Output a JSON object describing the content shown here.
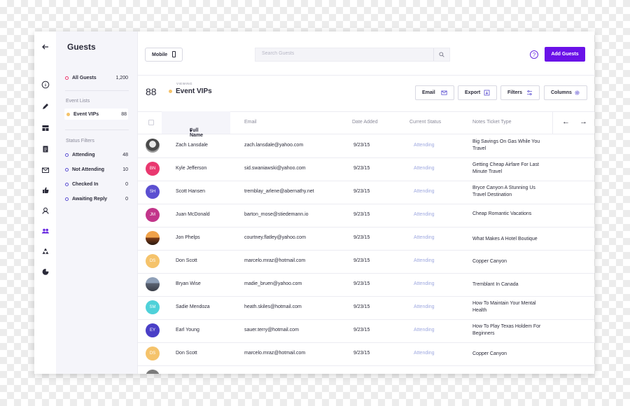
{
  "rail": {
    "icons": [
      "back-arrow-icon",
      "info-icon",
      "pen-icon",
      "dashboard-icon",
      "clipboard-icon",
      "mail-icon",
      "thumbs-up-icon",
      "person-icon",
      "group-icon",
      "recycle-icon",
      "pie-chart-icon"
    ]
  },
  "sidebar": {
    "title": "Guests",
    "all_guests": {
      "label": "All Guests",
      "count": "1,200"
    },
    "event_lists_heading": "Event Lists",
    "event_vips": {
      "label": "Event VIPs",
      "count": "88"
    },
    "status_filters_heading": "Status Filters",
    "filters": [
      {
        "label": "Attending",
        "count": "48"
      },
      {
        "label": "Not Attending",
        "count": "10"
      },
      {
        "label": "Checked In",
        "count": "0"
      },
      {
        "label": "Awaiting Reply",
        "count": "0"
      }
    ]
  },
  "topbar": {
    "mobile_label": "Mobile",
    "search_placeholder": "Search Guests",
    "add_label": "Add Guests",
    "help_glyph": "?"
  },
  "header": {
    "count": "88",
    "viewing_label": "VIEWING",
    "title": "Event VIPs",
    "buttons": [
      "Email",
      "Export",
      "Filters",
      "Columns"
    ]
  },
  "table": {
    "columns": [
      "Full Name",
      "Email",
      "Date Added",
      "Current Status",
      "Notes Ticket Type"
    ],
    "rows": [
      {
        "initials": "",
        "color": "#7c8b86",
        "name": "Zach Lansdale",
        "email": "zach.lansdale@yahoo.com",
        "date": "9/23/15",
        "status": "Attending",
        "note": "Big Savings On Gas While You Travel"
      },
      {
        "initials": "BN",
        "color": "#e9386f",
        "name": "Kyle Jefferson",
        "email": "sid.swaniawski@yahoo.com",
        "date": "9/23/15",
        "status": "Attending",
        "note": "Getting Cheap Airfare For Last Minute Travel"
      },
      {
        "initials": "SH",
        "color": "#5b4fd1",
        "name": "Scott Hansen",
        "email": "tremblay_arlene@abernathy.net",
        "date": "9/23/15",
        "status": "Attending",
        "note": "Bryce Canyon A Stunning Us Travel Destination"
      },
      {
        "initials": "JM",
        "color": "#c2358a",
        "name": "Juan McDonald",
        "email": "barton_mose@stiedemann.io",
        "date": "9/23/15",
        "status": "Attending",
        "note": "Cheap Romantic Vacations"
      },
      {
        "initials": "",
        "color": "#b86a2a",
        "name": "Jon Phelps",
        "email": "courtney.flatley@yahoo.com",
        "date": "9/23/15",
        "status": "Attending",
        "note": "What Makes A Hotel Boutique"
      },
      {
        "initials": "DS",
        "color": "#f5c36b",
        "name": "Don Scott",
        "email": "marcelo.mraz@hotmail.com",
        "date": "9/23/15",
        "status": "Attending",
        "note": "Copper Canyon"
      },
      {
        "initials": "",
        "color": "#6b7382",
        "name": "Bryan Wise",
        "email": "madie_bruen@yahoo.com",
        "date": "9/23/15",
        "status": "Attending",
        "note": "Tremblant In Canada"
      },
      {
        "initials": "SM",
        "color": "#4fd1d9",
        "name": "Sadie Mendoza",
        "email": "heath.skiles@hotmail.com",
        "date": "9/23/15",
        "status": "Attending",
        "note": "How To Maintain Your Mental Health"
      },
      {
        "initials": "EY",
        "color": "#4a3fc7",
        "name": "Earl Young",
        "email": "sauer.terry@hotmail.com",
        "date": "9/23/15",
        "status": "Attending",
        "note": "How To Play Texas Holdem For Beginners"
      },
      {
        "initials": "DS",
        "color": "#f5c36b",
        "name": "Don Scott",
        "email": "marcelo.mraz@hotmail.com",
        "date": "9/23/15",
        "status": "Attending",
        "note": "Copper Canyon"
      }
    ]
  }
}
